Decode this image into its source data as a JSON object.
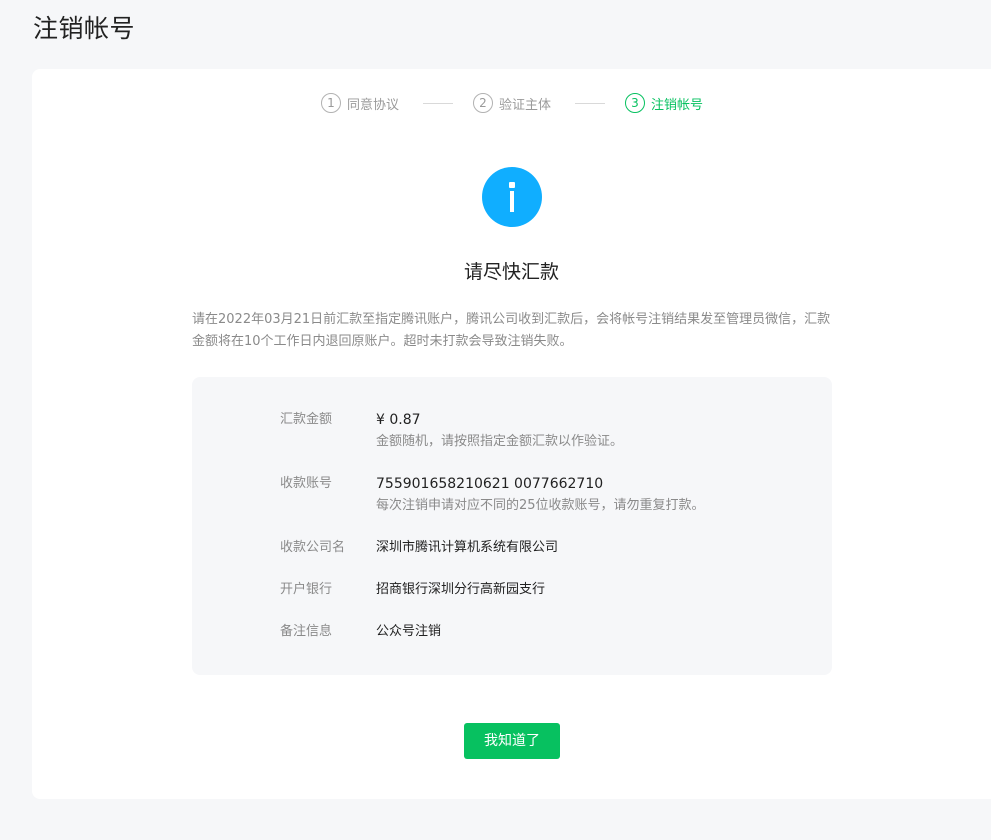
{
  "page": {
    "title": "注销帐号"
  },
  "steps": [
    {
      "num": "1",
      "label": "同意协议",
      "state": "done"
    },
    {
      "num": "2",
      "label": "验证主体",
      "state": "done"
    },
    {
      "num": "3",
      "label": "注销帐号",
      "state": "active"
    }
  ],
  "notice": {
    "icon": "info-icon",
    "icon_color": "#10aeff",
    "heading": "请尽快汇款",
    "description": "请在2022年03月21日前汇款至指定腾讯账户，腾讯公司收到汇款后，会将帐号注销结果发至管理员微信，汇款金额将在10个工作日内退回原账户。超时未打款会导致注销失败。"
  },
  "details": {
    "amount": {
      "label": "汇款金额",
      "value": "¥ 0.87",
      "hint": "金额随机，请按照指定金额汇款以作验证。"
    },
    "account": {
      "label": "收款账号",
      "value": "755901658210621 0077662710",
      "hint": "每次注销申请对应不同的25位收款账号，请勿重复打款。"
    },
    "company": {
      "label": "收款公司名",
      "value": "深圳市腾讯计算机系统有限公司"
    },
    "bank": {
      "label": "开户银行",
      "value": "招商银行深圳分行高新园支行"
    },
    "remark": {
      "label": "备注信息",
      "value": "公众号注销"
    }
  },
  "actions": {
    "confirm_label": "我知道了",
    "accent": "#07c160"
  }
}
